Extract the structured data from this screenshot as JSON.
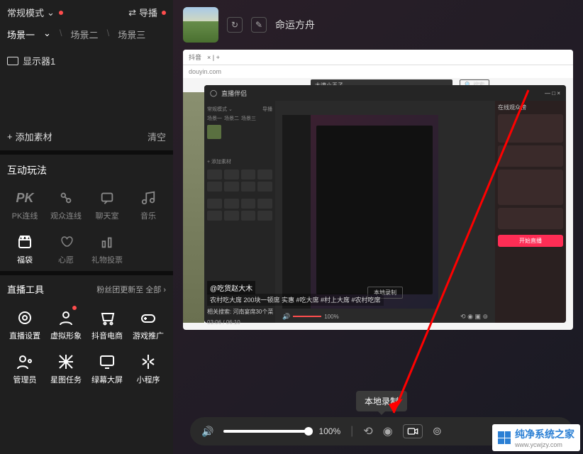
{
  "header": {
    "mode": "常规模式",
    "guide": "导播"
  },
  "scenes": {
    "items": [
      "场景一",
      "场景二",
      "场景三"
    ]
  },
  "monitor": "显示器1",
  "add_material": "添加素材",
  "clear": "清空",
  "section_play": "互动玩法",
  "play_grid": [
    {
      "label": "PK连线",
      "icon": "PK"
    },
    {
      "label": "观众连线",
      "icon": "link"
    },
    {
      "label": "聊天室",
      "icon": "chat"
    },
    {
      "label": "音乐",
      "icon": "music"
    },
    {
      "label": "福袋",
      "icon": "bag",
      "active": true
    },
    {
      "label": "心愿",
      "icon": "heart"
    },
    {
      "label": "礼物投票",
      "icon": "vote"
    },
    {
      "label": "",
      "icon": ""
    }
  ],
  "section_tools": "直播工具",
  "tools_link": "粉丝团更新至 全部",
  "tools_grid": [
    {
      "label": "直播设置",
      "icon": "gear"
    },
    {
      "label": "虚拟形象",
      "icon": "avatar",
      "dot": true
    },
    {
      "label": "抖音电商",
      "icon": "cart"
    },
    {
      "label": "游戏推广",
      "icon": "gamepad"
    },
    {
      "label": "管理员",
      "icon": "admin"
    },
    {
      "label": "星图任务",
      "icon": "star"
    },
    {
      "label": "绿幕大屏",
      "icon": "screen"
    },
    {
      "label": "小程序",
      "icon": "app"
    }
  ],
  "game_name": "命运方舟",
  "browser": {
    "tab": "抖音",
    "url": "douyin.com"
  },
  "inner": {
    "title": "直播伴侣",
    "search_text": "大漠小王子",
    "search_btn": "搜索",
    "red_btn": "开始直播",
    "caption": "@吃货赵大木",
    "sub_caption": "农村吃大席 200块一顿席 实惠 #吃大席  #村上大席  #农村吃席",
    "related": "相关搜索: 河南宴席30个菜",
    "time": "03:06 / 06:10",
    "right_label": "在线观众榜"
  },
  "tooltip": "本地录制",
  "volume": "100%",
  "watermark": {
    "title": "纯净系统之家",
    "url": "www.ycwjzy.com"
  }
}
